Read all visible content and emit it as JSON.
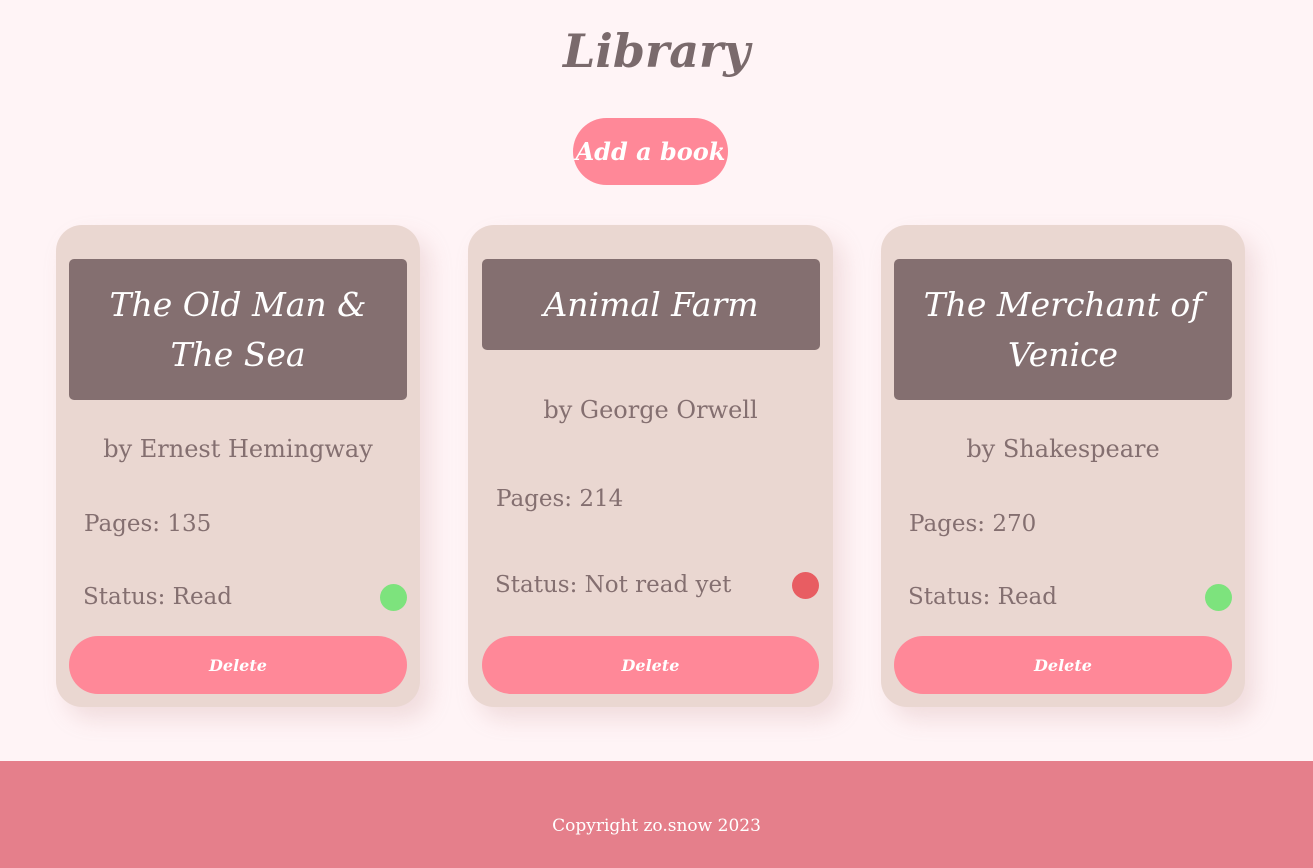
{
  "header": {
    "title": "Library",
    "add_button_label": "Add a book"
  },
  "colors": {
    "background": "#fff4f6",
    "accent": "#ff8898",
    "card": "#ead7d1",
    "title_box": "#846f70",
    "status_read": "#7de37d",
    "status_not_read": "#e85d62",
    "footer": "#e57f8b"
  },
  "books": [
    {
      "title": "The Old Man & The Sea",
      "author": "by Ernest Hemingway",
      "pages": "Pages: 135",
      "status": "Status: Read",
      "status_indicator": "read",
      "delete_label": "Delete"
    },
    {
      "title": "Animal Farm",
      "author": "by George Orwell",
      "pages": "Pages: 214",
      "status": "Status: Not read yet",
      "status_indicator": "not-read",
      "delete_label": "Delete"
    },
    {
      "title": "The Merchant of Venice",
      "author": "by Shakespeare",
      "pages": "Pages: 270",
      "status": "Status: Read",
      "status_indicator": "read",
      "delete_label": "Delete"
    }
  ],
  "footer": {
    "text": "Copyright zo.snow 2023"
  }
}
